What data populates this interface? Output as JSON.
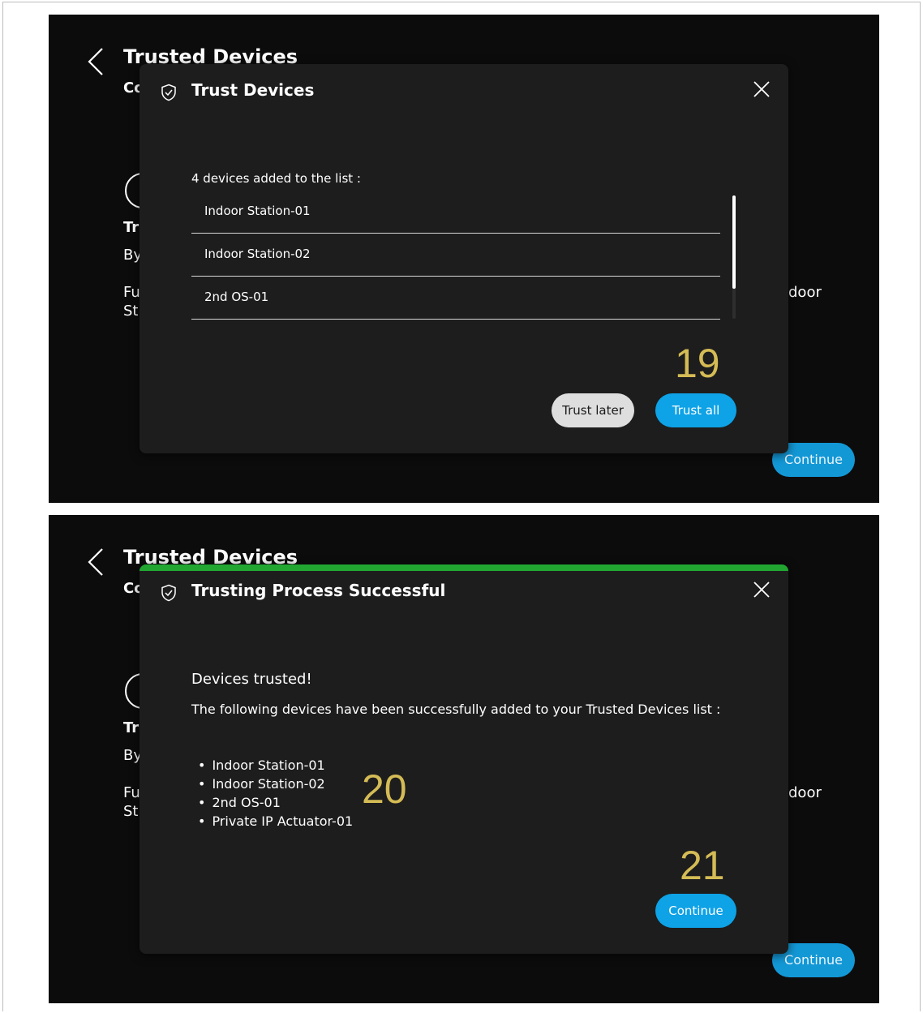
{
  "background": {
    "title": "Trusted Devices",
    "frag_co": "Co",
    "frag_tr": "Tr",
    "frag_by": "By",
    "frag_fu": "Fu",
    "frag_st": "St",
    "frag_door": "door",
    "continue_label": "Continue"
  },
  "screen1": {
    "dialog": {
      "title": "Trust Devices",
      "count_text": "4 devices added to the list :",
      "devices": [
        "Indoor Station-01",
        "Indoor Station-02",
        "2nd OS-01"
      ],
      "trust_later_label": "Trust later",
      "trust_all_label": "Trust all"
    },
    "callout": "19"
  },
  "screen2": {
    "dialog": {
      "title": "Trusting Process Successful",
      "heading": "Devices trusted!",
      "description": "The following devices have been successfully added to your Trusted Devices list :",
      "devices": [
        "Indoor Station-01",
        "Indoor Station-02",
        "2nd OS-01",
        "Private IP Actuator-01"
      ],
      "continue_label": "Continue"
    },
    "callout_list": "20",
    "callout_button": "21"
  },
  "colors": {
    "accent": "#0ea2e6",
    "success": "#21a632",
    "callout": "#d4bb55",
    "modal_bg": "#1d1d1d",
    "page_bg": "#0c0c0c"
  },
  "icons": [
    "chevron-left-icon",
    "shield-check-icon",
    "close-icon"
  ]
}
